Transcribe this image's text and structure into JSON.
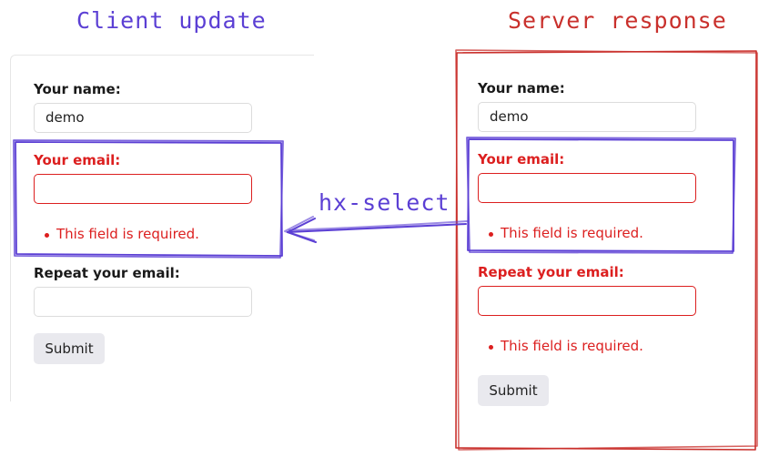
{
  "titles": {
    "left": "Client update",
    "right": "Server response"
  },
  "arrow": {
    "label": "hx-select"
  },
  "colors": {
    "client": "#5b3fd4",
    "server": "#c9302c",
    "error": "#dc1f1f"
  },
  "client": {
    "name_label": "Your name:",
    "name_value": "demo",
    "email_label": "Your email:",
    "email_error": "This field is required.",
    "repeat_label": "Repeat your email:",
    "submit": "Submit"
  },
  "server": {
    "name_label": "Your name:",
    "name_value": "demo",
    "email_label": "Your email:",
    "email_error": "This field is required.",
    "repeat_label": "Repeat your email:",
    "repeat_error": "This field is required.",
    "submit": "Submit"
  }
}
